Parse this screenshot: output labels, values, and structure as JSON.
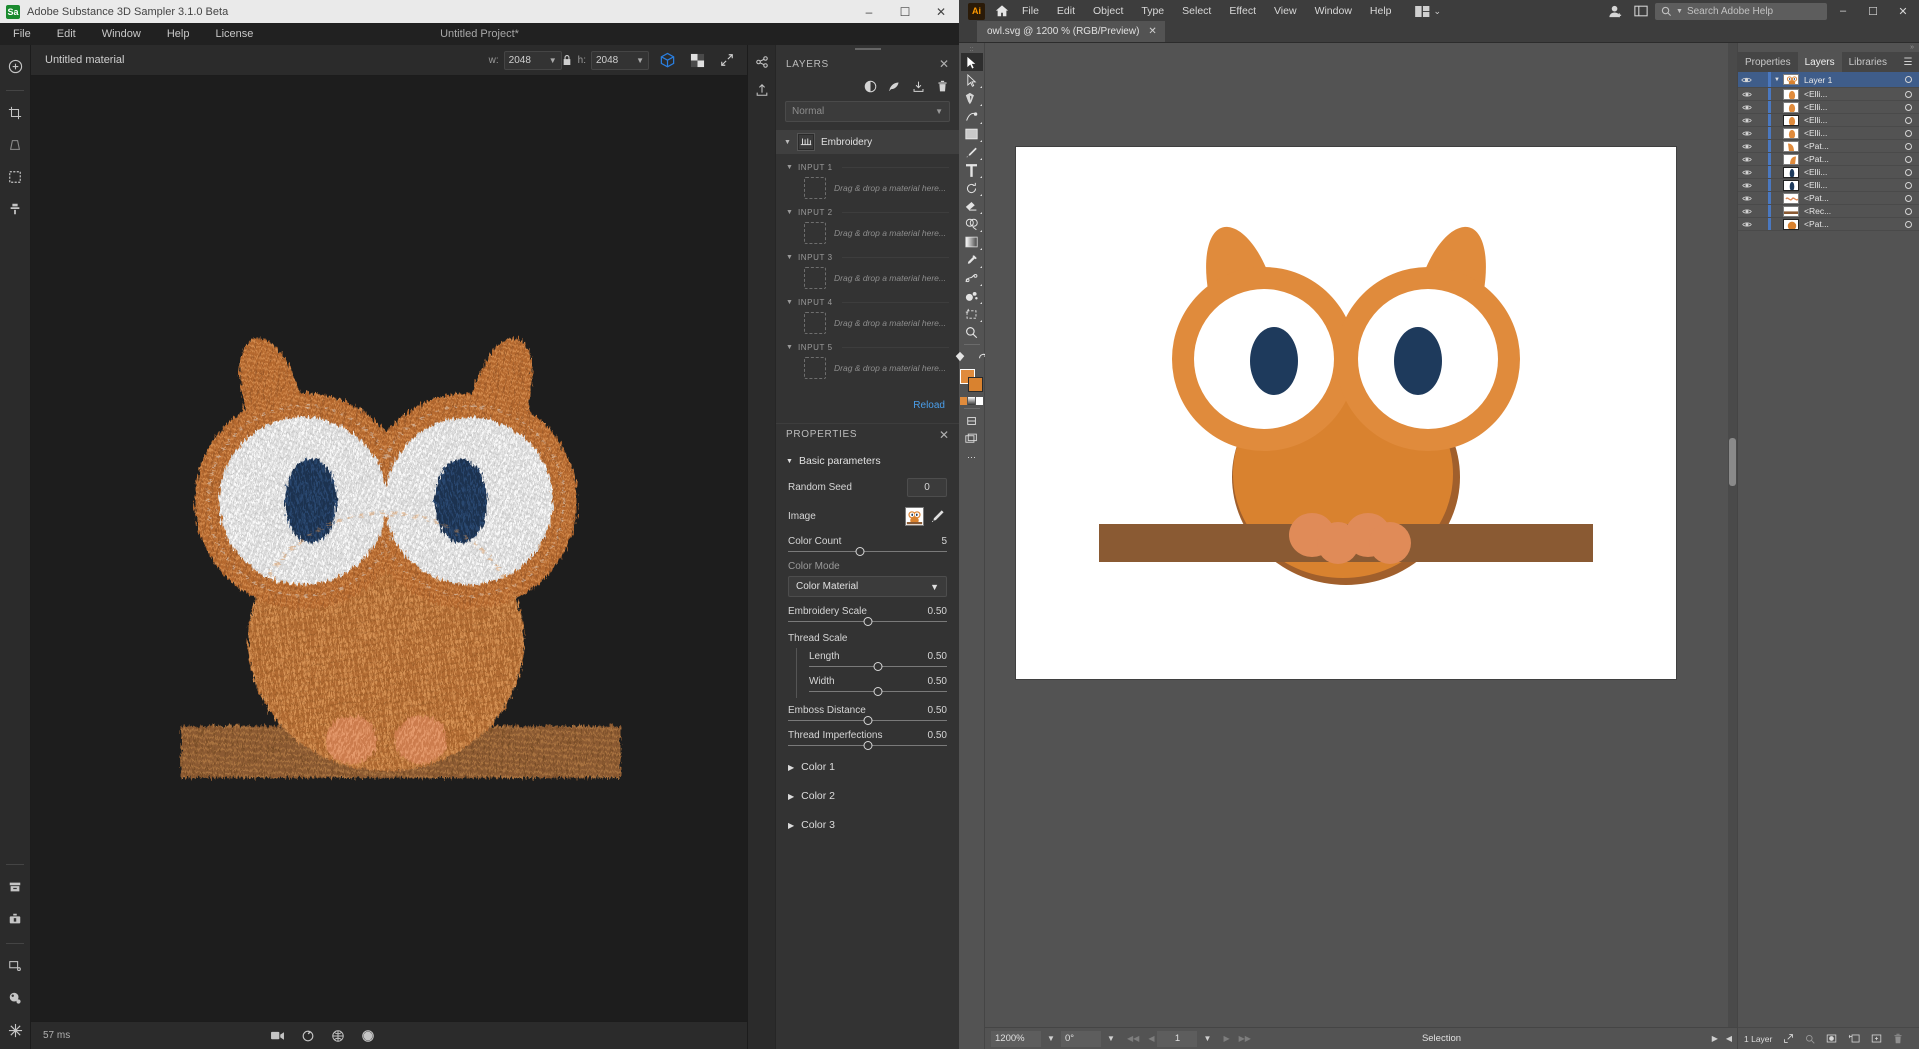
{
  "substance": {
    "window": {
      "title": "Adobe Substance 3D Sampler 3.1.0 Beta",
      "logo_icon": "substance-logo-icon",
      "minimize_label": "–",
      "maximize_label": "☐",
      "close_label": "✕"
    },
    "menu": [
      "File",
      "Edit",
      "Window",
      "Help",
      "License"
    ],
    "project_title": "Untitled Project*",
    "material_name": "Untitled material",
    "size": {
      "width_label": "w:",
      "width_value": "2048",
      "lock_icon": "lock-icon",
      "height_label": "h:",
      "height_value": "2048"
    },
    "view_buttons": [
      {
        "name": "3d-view-button",
        "icon": "cube-icon",
        "active": true
      },
      {
        "name": "2d-view-button",
        "icon": "checker-icon",
        "active": false
      },
      {
        "name": "fullscreen-button",
        "icon": "expand-icon",
        "active": false
      }
    ],
    "left_tools": [
      "add-icon",
      "crop-icon",
      "perspective-icon",
      "selection-icon",
      "clone-stamp-icon",
      "archive-icon",
      "toolbox-icon",
      "screen-icon",
      "sphere-icon",
      "snowflake-icon"
    ],
    "right_tools": [
      "share-icon",
      "export-icon"
    ],
    "status": {
      "render_time": "57 ms"
    },
    "viewport_icons": [
      "camera-icon",
      "rotate-icon",
      "grid-icon",
      "light-icon"
    ],
    "layers_panel": {
      "title": "LAYERS",
      "close_icon": "close-icon",
      "tools": [
        "mask-icon",
        "filter-icon",
        "import-icon",
        "delete-icon"
      ],
      "blend_mode": "Normal",
      "layer": {
        "name": "Embroidery",
        "thumb_icon": "embroidery-thumb-icon"
      },
      "inputs": [
        {
          "label": "INPUT 1",
          "placeholder": "Drag & drop a material here..."
        },
        {
          "label": "INPUT 2",
          "placeholder": "Drag & drop a material here..."
        },
        {
          "label": "INPUT 3",
          "placeholder": "Drag & drop a material here..."
        },
        {
          "label": "INPUT 4",
          "placeholder": "Drag & drop a material here..."
        },
        {
          "label": "INPUT 5",
          "placeholder": "Drag & drop a material here..."
        }
      ],
      "reload_label": "Reload"
    },
    "properties_panel": {
      "title": "PROPERTIES",
      "close_icon": "close-icon",
      "section": "Basic parameters",
      "random_seed": {
        "label": "Random Seed",
        "value": "0"
      },
      "image": {
        "label": "Image",
        "thumb_icon": "owl-thumb-icon",
        "pen_icon": "pen-icon"
      },
      "color_count": {
        "label": "Color Count",
        "value": "5",
        "pct": 38
      },
      "color_mode": {
        "label": "Color Mode",
        "value": "Color Material"
      },
      "embroidery_scale": {
        "label": "Embroidery Scale",
        "value": "0.50",
        "pct": 50
      },
      "thread_scale": {
        "label": "Thread Scale",
        "length": {
          "label": "Length",
          "value": "0.50",
          "pct": 50
        },
        "width": {
          "label": "Width",
          "value": "0.50",
          "pct": 50
        }
      },
      "emboss_distance": {
        "label": "Emboss Distance",
        "value": "0.50",
        "pct": 50
      },
      "thread_imperfections": {
        "label": "Thread Imperfections",
        "value": "0.50",
        "pct": 50
      },
      "color_groups": [
        "Color 1",
        "Color 2",
        "Color 3"
      ]
    }
  },
  "illustrator": {
    "logo": "Ai",
    "home_icon": "home-icon",
    "menu": [
      "File",
      "Edit",
      "Object",
      "Type",
      "Select",
      "Effect",
      "View",
      "Window",
      "Help"
    ],
    "arrange_icon": "arrange-documents-icon",
    "arrange_caret": "⌄",
    "right_icons": [
      "user-add-icon",
      "workspace-icon"
    ],
    "search": {
      "placeholder": "Search Adobe Help",
      "icon": "search-icon"
    },
    "window_buttons": {
      "minimize": "–",
      "maximize": "☐",
      "close": "✕"
    },
    "document_tab": {
      "label": "owl.svg @ 1200 % (RGB/Preview)",
      "close": "✕"
    },
    "tools": [
      "selection-tool-icon",
      "direct-selection-tool-icon",
      "pen-tool-icon",
      "curvature-tool-icon",
      "rectangle-tool-icon",
      "paintbrush-tool-icon",
      "type-tool-icon",
      "rotate-tool-icon",
      "eraser-tool-icon",
      "shape-builder-tool-icon",
      "gradient-tool-icon",
      "eyedropper-tool-icon",
      "blend-tool-icon",
      "symbol-sprayer-tool-icon",
      "artboard-tool-icon",
      "zoom-tool-icon"
    ],
    "toolbar_extra": [
      "fill-stroke-swatches",
      "color-modes",
      "draw-modes-icon",
      "screen-mode-icon",
      "more-tools-icon"
    ],
    "statusbar": {
      "zoom": "1200%",
      "rotation": "0°",
      "artboard_number": "1",
      "status_text": "Selection",
      "prev_icon": "prev-icon",
      "next_icon": "next-icon"
    },
    "panel_tabs": [
      "Properties",
      "Layers",
      "Libraries"
    ],
    "active_panel_tab": "Layers",
    "panel_menu_icon": "panel-menu-icon",
    "layers": {
      "root": {
        "name": "Layer 1",
        "thumb": "owl-thumb",
        "expanded": true
      },
      "items": [
        {
          "name": "<Elli...",
          "thumb": "ellipse-orange"
        },
        {
          "name": "<Elli...",
          "thumb": "ellipse-orange"
        },
        {
          "name": "<Elli...",
          "thumb": "ellipse-orange"
        },
        {
          "name": "<Elli...",
          "thumb": "ellipse-orange"
        },
        {
          "name": "<Pat...",
          "thumb": "path-orange"
        },
        {
          "name": "<Pat...",
          "thumb": "path-orange"
        },
        {
          "name": "<Elli...",
          "thumb": "ellipse-navy"
        },
        {
          "name": "<Elli...",
          "thumb": "ellipse-navy"
        },
        {
          "name": "<Pat...",
          "thumb": "path-white"
        },
        {
          "name": "<Rec...",
          "thumb": "rect-brown"
        },
        {
          "name": "<Pat...",
          "thumb": "path-orange-fill"
        }
      ],
      "footer": {
        "count": "1 Layer",
        "icons": [
          "locate-object-icon",
          "make-mask-icon",
          "new-sublayer-icon",
          "new-layer-icon",
          "delete-layer-icon"
        ]
      }
    },
    "artwork": {
      "name": "owl-illustration",
      "colors": {
        "ear_body_orange": "#e08b3c",
        "body_fill": "#d9822f",
        "outline_brown": "#a05f2c",
        "eye_navy": "#1e3a5c",
        "eye_white": "#ffffff",
        "branch_brown": "#8a5a33",
        "feet_orange": "#e08b58"
      }
    }
  }
}
